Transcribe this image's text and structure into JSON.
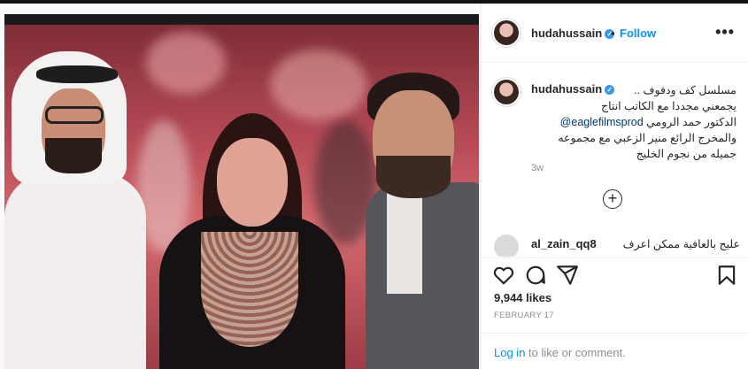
{
  "photo": {
    "description_icon": "post-photo"
  },
  "header": {
    "username": "hudahussain",
    "verified_icon": "verified-badge-icon",
    "separator": "•",
    "follow_label": "Follow",
    "more_icon": "more-options-icon",
    "more_glyph": "•••"
  },
  "caption": {
    "username": "hudahussain",
    "lines": [
      "مسلسل كف ودفوف ..",
      "يجمعني مجددا مع الكاتب انتاج",
      "الدكتور حمد الرومي",
      "والمخرج الرائع منير الزعبي مع مجموعه",
      "جميله من نجوم الخليج"
    ],
    "mention": "@eaglefilmsprod",
    "time": "3w",
    "load_more_glyph": "+"
  },
  "comment": {
    "username": "al_zain_qq8",
    "text": "عليج بالعافية ممكن اعرف"
  },
  "actions": {
    "like_icon": "heart-icon",
    "comment_icon": "comment-icon",
    "share_icon": "share-icon",
    "save_icon": "bookmark-icon"
  },
  "likes": "9,944 likes",
  "date": "FEBRUARY 17",
  "login": {
    "link": "Log in",
    "rest": " to like or comment."
  },
  "colors": {
    "accent": "#0095f6",
    "verified": "#3897f0",
    "muted": "#8e8e8e",
    "text": "#262626"
  }
}
